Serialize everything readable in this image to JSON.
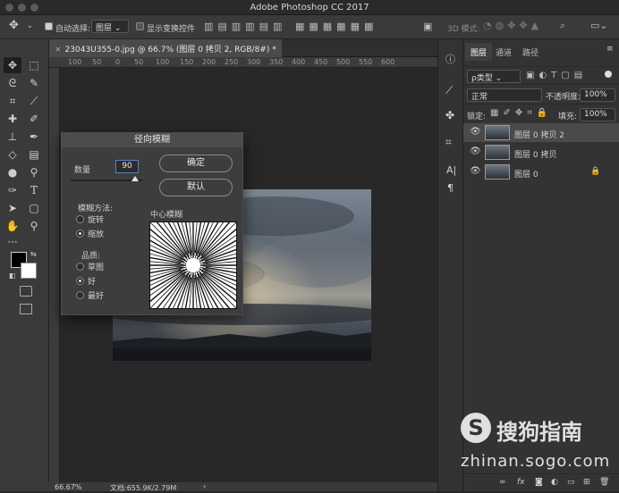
{
  "app": {
    "title": "Adobe Photoshop CC 2017"
  },
  "options_bar": {
    "auto_select_label": "自动选择:",
    "auto_select_value": "图层",
    "show_transform_label": "显示变换控件",
    "mode_3d_label": "3D 模式:"
  },
  "document": {
    "tab_title": "23043U355-0.jpg @ 66.7% (图层 0 拷贝 2, RGB/8#) *",
    "ruler_ticks": [
      "100",
      "50",
      "0",
      "50",
      "100",
      "150",
      "200",
      "250",
      "300",
      "350",
      "400",
      "450",
      "500",
      "550",
      "600"
    ]
  },
  "status": {
    "zoom": "66.67%",
    "doc_info": "文档:655.9K/2.79M"
  },
  "dialog": {
    "title": "径向模糊",
    "amount_label": "数量",
    "amount_value": "90",
    "amount_fraction": 0.9,
    "ok_label": "确定",
    "default_label": "默认",
    "method_label": "模糊方法:",
    "method_options": [
      "旋转",
      "缩放"
    ],
    "method_selected": "缩放",
    "quality_label": "品质:",
    "quality_options": [
      "草图",
      "好",
      "最好"
    ],
    "quality_selected": "好",
    "center_label": "中心模糊"
  },
  "panel": {
    "tabs": [
      "图层",
      "通道",
      "路径"
    ],
    "active_tab": "图层",
    "filter_value": "ρ类型",
    "blend_mode": "正常",
    "opacity_label": "不透明度:",
    "opacity_value": "100%",
    "lock_label": "锁定:",
    "fill_label": "填充:",
    "fill_value": "100%",
    "layers": [
      {
        "name": "图层 0 拷贝 2",
        "selected": true,
        "locked": false
      },
      {
        "name": "图层 0 拷贝",
        "selected": false,
        "locked": false
      },
      {
        "name": "图层 0",
        "selected": false,
        "locked": true
      }
    ],
    "footer_icons": [
      "link-icon",
      "fx-icon",
      "mask-icon",
      "adjustment-icon",
      "folder-icon",
      "new-layer-icon",
      "trash-icon"
    ]
  },
  "watermark": {
    "brand": "搜狗指南",
    "url": "zhinan.sogo.com"
  }
}
